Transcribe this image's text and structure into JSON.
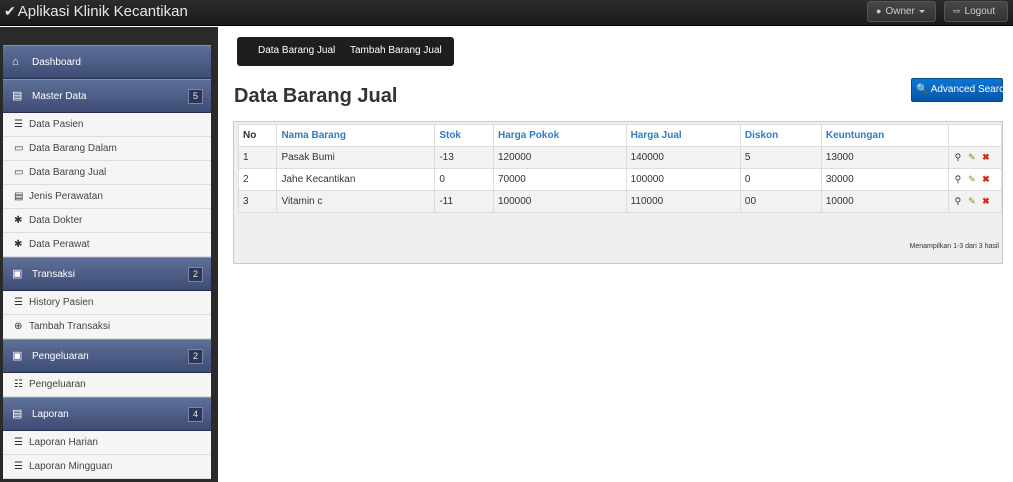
{
  "app": {
    "title": "Aplikasi Klinik Kecantikan",
    "user_label": "Owner",
    "logout_label": "Logout"
  },
  "sidebar": {
    "sections": [
      {
        "label": "Dashboard",
        "icon": "home-icon",
        "badge": "",
        "items": []
      },
      {
        "label": "Master Data",
        "icon": "table-icon",
        "badge": "5",
        "items": [
          {
            "label": "Data Pasien",
            "icon": "list-icon"
          },
          {
            "label": "Data Barang Dalam",
            "icon": "hdd-icon"
          },
          {
            "label": "Data Barang Jual",
            "icon": "hdd-icon"
          },
          {
            "label": "Jenis Perawatan",
            "icon": "list-alt-icon"
          },
          {
            "label": "Data Dokter",
            "icon": "asterisk-icon"
          },
          {
            "label": "Data Perawat",
            "icon": "asterisk-icon"
          }
        ]
      },
      {
        "label": "Transaksi",
        "icon": "briefcase-icon",
        "badge": "2",
        "items": [
          {
            "label": "History Pasien",
            "icon": "list-icon"
          },
          {
            "label": "Tambah Transaksi",
            "icon": "plus-circle-icon"
          }
        ]
      },
      {
        "label": "Pengeluaran",
        "icon": "briefcase-icon",
        "badge": "2",
        "items": [
          {
            "label": "Pengeluaran",
            "icon": "th-icon"
          }
        ]
      },
      {
        "label": "Laporan",
        "icon": "table-icon",
        "badge": "4",
        "items": [
          {
            "label": "Laporan Harian",
            "icon": "list-icon"
          },
          {
            "label": "Laporan Mingguan",
            "icon": "list-icon"
          }
        ]
      }
    ]
  },
  "main": {
    "tabs": [
      "Data Barang Jual",
      "Tambah Barang Jual"
    ],
    "page_title": "Data Barang Jual",
    "advanced_search_label": "Advanced Search",
    "table": {
      "columns": [
        "No",
        "Nama Barang",
        "Stok",
        "Harga Pokok",
        "Harga Jual",
        "Diskon",
        "Keuntungan"
      ],
      "rows": [
        [
          "1",
          "Pasak Bumi",
          "-13",
          "120000",
          "140000",
          "5",
          "13000"
        ],
        [
          "2",
          "Jahe Kecantikan",
          "0",
          "70000",
          "100000",
          "0",
          "30000"
        ],
        [
          "3",
          "Vitamin c",
          "-11",
          "100000",
          "110000",
          "00",
          "10000"
        ]
      ]
    },
    "summary": "Menampilkan 1-3 dari 3 hasil"
  },
  "colors": {
    "navbar": "#1b1b1b",
    "sidebar_section": "#4a5a82",
    "link": "#2f7cc2",
    "primary_button": "#0a6cc6",
    "delete_icon": "#d42a1a",
    "edit_icon": "#6a9a1f"
  }
}
